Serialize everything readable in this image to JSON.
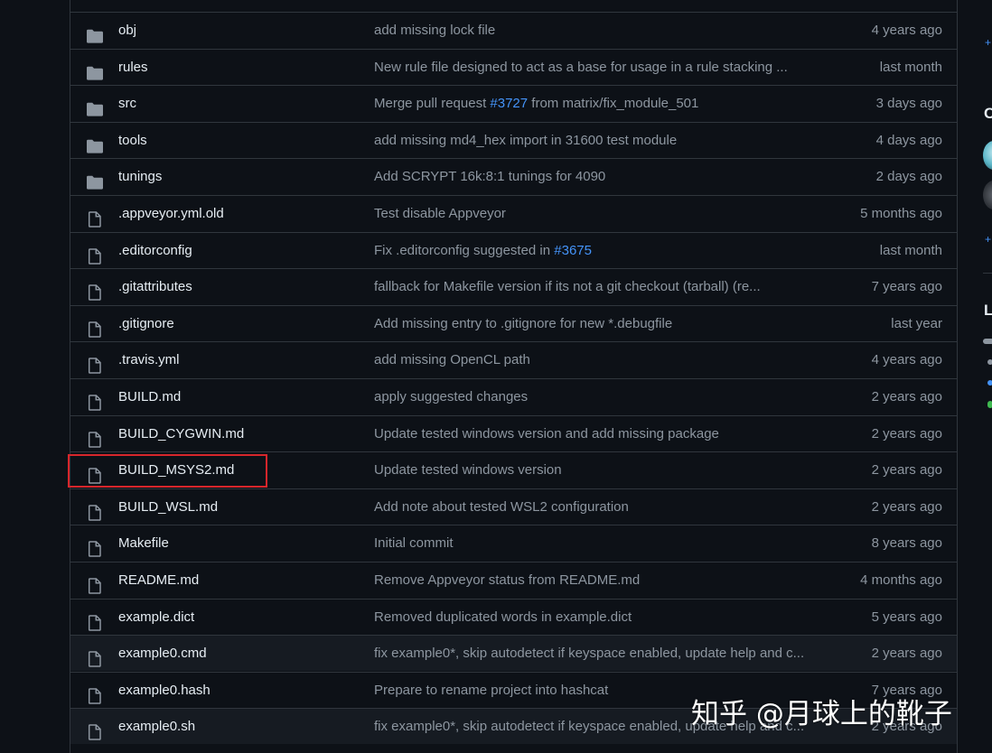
{
  "files": [
    {
      "name": "obj",
      "type": "folder",
      "message": "add missing lock file",
      "age": "4 years ago"
    },
    {
      "name": "rules",
      "type": "folder",
      "message": "New rule file designed to act as a base for usage in a rule stacking ...",
      "age": "last month"
    },
    {
      "name": "src",
      "type": "folder",
      "message_pre": "Merge pull request ",
      "message_link": "#3727",
      "message_post": " from matrix/fix_module_501",
      "age": "3 days ago"
    },
    {
      "name": "tools",
      "type": "folder",
      "message": "add missing md4_hex import in 31600 test module",
      "age": "4 days ago"
    },
    {
      "name": "tunings",
      "type": "folder",
      "message": "Add SCRYPT 16k:8:1 tunings for 4090",
      "age": "2 days ago"
    },
    {
      "name": ".appveyor.yml.old",
      "type": "file",
      "message": "Test disable Appveyor",
      "age": "5 months ago"
    },
    {
      "name": ".editorconfig",
      "type": "file",
      "message_pre": "Fix .editorconfig suggested in ",
      "message_link": "#3675",
      "message_post": "",
      "age": "last month"
    },
    {
      "name": ".gitattributes",
      "type": "file",
      "message": "fallback for Makefile version if its not a git checkout (tarball) (re...",
      "age": "7 years ago"
    },
    {
      "name": ".gitignore",
      "type": "file",
      "message": "Add missing entry to .gitignore for new *.debugfile",
      "age": "last year"
    },
    {
      "name": ".travis.yml",
      "type": "file",
      "message": "add missing OpenCL path",
      "age": "4 years ago"
    },
    {
      "name": "BUILD.md",
      "type": "file",
      "message": "apply suggested changes",
      "age": "2 years ago"
    },
    {
      "name": "BUILD_CYGWIN.md",
      "type": "file",
      "message": "Update tested windows version and add missing package",
      "age": "2 years ago"
    },
    {
      "name": "BUILD_MSYS2.md",
      "type": "file",
      "message": "Update tested windows version",
      "age": "2 years ago"
    },
    {
      "name": "BUILD_WSL.md",
      "type": "file",
      "message": "Add note about tested WSL2 configuration",
      "age": "2 years ago"
    },
    {
      "name": "Makefile",
      "type": "file",
      "message": "Initial commit",
      "age": "8 years ago"
    },
    {
      "name": "README.md",
      "type": "file",
      "message": "Remove Appveyor status from README.md",
      "age": "4 months ago"
    },
    {
      "name": "example.dict",
      "type": "file",
      "message": "Removed duplicated words in example.dict",
      "age": "5 years ago"
    },
    {
      "name": "example0.cmd",
      "type": "file",
      "message": "fix example0*, skip autodetect if keyspace enabled, update help and c...",
      "age": "2 years ago"
    },
    {
      "name": "example0.hash",
      "type": "file",
      "message": "Prepare to rename project into hashcat",
      "age": "7 years ago"
    },
    {
      "name": "example0.sh",
      "type": "file",
      "message": "fix example0*, skip autodetect if keyspace enabled, update help and c...",
      "age": "2 years ago"
    }
  ],
  "sidebar": {
    "plus_1": "+",
    "letter_c": "C",
    "plus_2": "+",
    "letter_l": "L"
  },
  "watermark": "知乎 @月球上的靴子",
  "colors": {
    "background": "#0d1117",
    "border": "#30363d",
    "text_primary": "#e6edf3",
    "text_muted": "#8d96a0",
    "link": "#4493f8",
    "highlight": "#d7262b"
  }
}
